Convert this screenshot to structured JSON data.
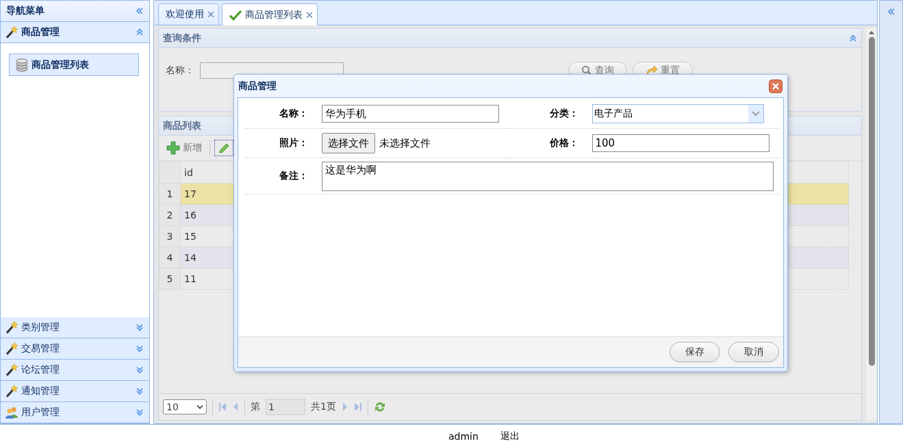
{
  "sidebar": {
    "title": "导航菜单",
    "groups": [
      {
        "label": "商品管理",
        "kind": "module",
        "expanded": true,
        "items": [
          {
            "label": "商品管理列表",
            "selected": true
          }
        ]
      },
      {
        "label": "类别管理",
        "kind": "module",
        "expanded": false
      },
      {
        "label": "交易管理",
        "kind": "module",
        "expanded": false
      },
      {
        "label": "论坛管理",
        "kind": "module",
        "expanded": false
      },
      {
        "label": "通知管理",
        "kind": "module",
        "expanded": false
      },
      {
        "label": "用户管理",
        "kind": "users",
        "expanded": false
      }
    ]
  },
  "tabs": [
    {
      "label": "欢迎使用",
      "kind": "plain",
      "selected": false
    },
    {
      "label": "商品管理列表",
      "kind": "check",
      "selected": true
    }
  ],
  "query_panel": {
    "title": "查询条件",
    "field_label": "名称：",
    "buttons": [
      {
        "label": "查询",
        "kind": "search"
      },
      {
        "label": "重置",
        "kind": "reset"
      }
    ]
  },
  "grid": {
    "title": "商品列表",
    "toolbar": [
      {
        "kind": "add",
        "label": "新增"
      },
      {
        "kind": "edit"
      }
    ],
    "columns": [
      "id"
    ],
    "rows": [
      {
        "number": "1",
        "id": "17",
        "selected": true
      },
      {
        "number": "2",
        "id": "16",
        "selected": false
      },
      {
        "number": "3",
        "id": "15",
        "selected": false
      },
      {
        "number": "4",
        "id": "14",
        "selected": false
      },
      {
        "number": "5",
        "id": "11",
        "selected": false
      }
    ]
  },
  "pager": {
    "page_size": "10",
    "page_label": "第",
    "page": "1",
    "total": "共1页"
  },
  "dialog": {
    "title": "商品管理",
    "fields": [
      {
        "kind": "text",
        "label": "名称：",
        "value": "华为手机"
      },
      {
        "kind": "select",
        "label": "分类：",
        "value": "电子产品"
      },
      {
        "kind": "file",
        "label": "照片：",
        "button": "选择文件",
        "value": "未选择文件"
      },
      {
        "kind": "text",
        "label": "价格：",
        "value": "100"
      },
      {
        "kind": "textarea",
        "label": "备注：",
        "value": "这是华为啊"
      }
    ],
    "buttons": [
      "保存",
      "取消"
    ]
  },
  "status_bar": {
    "user": "admin",
    "logout": "退出"
  }
}
